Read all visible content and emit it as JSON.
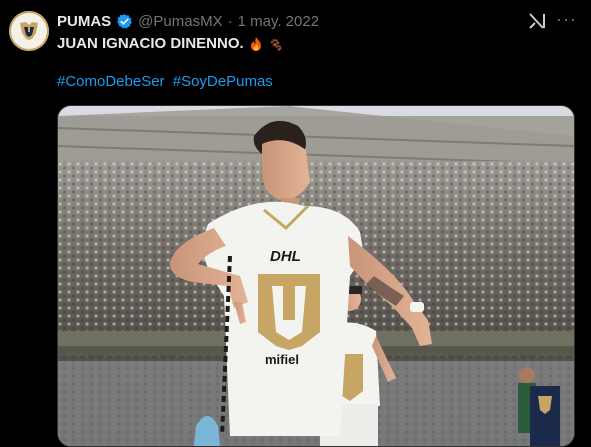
{
  "tweet": {
    "name": "PUMAS",
    "handle": "@PumasMX",
    "separator": "·",
    "date": "1 may. 2022",
    "text": "JUAN IGNACIO DINENNO.",
    "hashtags": [
      "#ComoDebeSer",
      "#SoyDePumas"
    ],
    "more_label": "···",
    "icons": {
      "avatar": "pumas-logo",
      "verified": "verified-badge-icon",
      "grok": "grok-icon",
      "more": "more-icon",
      "emoji_1": "fire-emoji-icon",
      "emoji_2": "paw-prints-emoji-icon"
    }
  },
  "media": {
    "shirt_sponsor": "DHL",
    "shorts_sponsor": "mifiel",
    "colors": {
      "accent": "#1d9bf0",
      "pumas_gold": "#c6a565",
      "kit_white": "#f3f3f0"
    }
  }
}
